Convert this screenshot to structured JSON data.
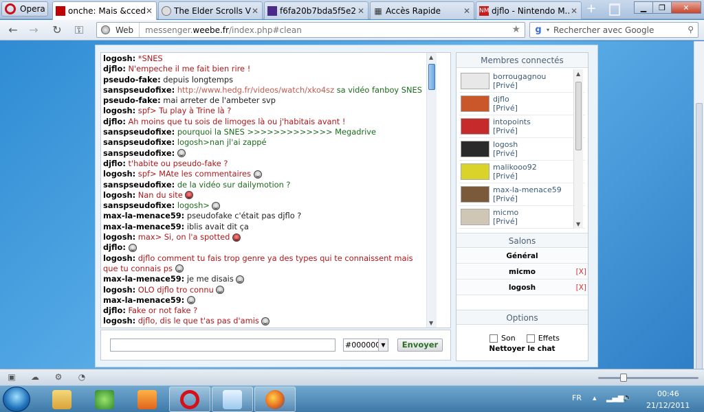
{
  "browser": {
    "menu_label": "Opera",
    "tabs": [
      {
        "title": "onche: Mais &cced...",
        "icon_color": "#c00000",
        "active": true
      },
      {
        "title": "The Elder Scrolls V: ...",
        "icon_color": "#888888",
        "active": false
      },
      {
        "title": "f6fa20b7bda5f5e23...",
        "icon_color": "#4b2a8a",
        "active": false
      },
      {
        "title": "Accès Rapide",
        "icon_color": "#556677",
        "active": false
      },
      {
        "title": "djflo - Nintendo M...",
        "icon_color": "#c81c1c",
        "active": false
      }
    ],
    "tab_icon_letters": [
      "",
      "",
      "",
      "",
      "NM"
    ],
    "address": {
      "web_label": "Web",
      "url_prefix": "messenger.",
      "url_domain": "weebe.fr",
      "url_suffix": "/index.php#clean"
    },
    "search_placeholder": "Rechercher avec Google"
  },
  "chat": {
    "messages": [
      {
        "user": "logosh:",
        "text": "*SNES",
        "color": "red"
      },
      {
        "user": "djflo:",
        "text": "N'empeche il me fait bien rire !",
        "color": "red"
      },
      {
        "user": "pseudo-fake:",
        "text": "depuis longtemps",
        "color": "dark"
      },
      {
        "user": "sanspseudofixe:",
        "text": "http://www.hedg.fr/videos/watch/xko4sz",
        "text2": " sa vidéo fanboy SNES",
        "color": "link"
      },
      {
        "user": "pseudo-fake:",
        "text": "mai arreter de l'ambeter svp",
        "color": "dark"
      },
      {
        "user": "logosh:",
        "text": "spf> Tu play à Trine là ?",
        "color": "red"
      },
      {
        "user": "djflo:",
        "text": "Ah moins que tu sois de limoges là ou j'habitais avant !",
        "color": "red"
      },
      {
        "user": "sanspseudofixe:",
        "text": "pourquoi la SNES >>>>>>>>>>>>> Megadrive",
        "color": "green"
      },
      {
        "user": "sanspseudofixe:",
        "text": "logosh>nan jl'ai zappé",
        "color": "green"
      },
      {
        "user": "sanspseudofixe:",
        "text": "",
        "color": "green",
        "smiley": true
      },
      {
        "user": "djflo:",
        "text": "t'habite ou pseudo-fake ?",
        "color": "red"
      },
      {
        "user": "logosh:",
        "text": "spf> MAte les commentaires",
        "color": "red",
        "smiley": true
      },
      {
        "user": "sanspseudofixe:",
        "text": "de la vidéo sur dailymotion ?",
        "color": "green"
      },
      {
        "user": "logosh:",
        "text": "Nan du site",
        "color": "red",
        "smiley": true,
        "smiley_red": true
      },
      {
        "user": "sanspseudofixe:",
        "text": "logosh>",
        "color": "green",
        "smiley": true
      },
      {
        "user": "max-la-menace59:",
        "text": "pseudofake c'était pas djflo ?",
        "color": "dark"
      },
      {
        "user": "max-la-menace59:",
        "text": "iblis avait dit ça",
        "color": "dark"
      },
      {
        "user": "logosh:",
        "text": "max> Si, on l'a spotted",
        "color": "red",
        "smiley": true,
        "smiley_red": true
      },
      {
        "user": "djflo:",
        "text": "",
        "color": "red",
        "smiley": true
      },
      {
        "user": "logosh:",
        "text": "djflo comment tu fais trop genre ya des types qui te connaissent mais que tu connais ps",
        "color": "red",
        "smiley": true
      },
      {
        "user": "max-la-menace59:",
        "text": "je me disais",
        "color": "dark",
        "smiley": true
      },
      {
        "user": "logosh:",
        "text": "OLO djflo tro connu",
        "color": "red",
        "smiley": true
      },
      {
        "user": "max-la-menace59:",
        "text": "",
        "color": "dark",
        "smiley": true
      },
      {
        "user": "djflo:",
        "text": "Fake or not fake ?",
        "color": "red"
      },
      {
        "user": "logosh:",
        "text": "djflo, dis le que t'as pas d'amis",
        "color": "red",
        "smiley": true
      }
    ],
    "color_value": "#000000",
    "send_label": "Envoyer"
  },
  "members": {
    "title": "Membres connectés",
    "list": [
      {
        "name": "borrougagnou",
        "status": "[Privé]",
        "avatar_color": "#e8e8e8"
      },
      {
        "name": "djflo",
        "status": "[Privé]",
        "avatar_color": "#c9572a"
      },
      {
        "name": "intopoints",
        "status": "[Privé]",
        "avatar_color": "#c62a2a"
      },
      {
        "name": "logosh",
        "status": "[Privé]",
        "avatar_color": "#2a2a2a"
      },
      {
        "name": "malikooo92",
        "status": "[Privé]",
        "avatar_color": "#d9d32a"
      },
      {
        "name": "max-la-menace59",
        "status": "[Privé]",
        "avatar_color": "#7a5a3a"
      },
      {
        "name": "micmo",
        "status": "[Privé]",
        "avatar_color": "#cfc6b5"
      }
    ]
  },
  "salons": {
    "title": "Salons",
    "list": [
      {
        "name": "Général",
        "close": ""
      },
      {
        "name": "micmo",
        "close": "[X]"
      },
      {
        "name": "logosh",
        "close": "[X]"
      }
    ]
  },
  "options": {
    "title": "Options",
    "sound_label": "Son",
    "effects_label": "Effets",
    "clear_label": "Nettoyer le chat"
  },
  "taskbar": {
    "lang": "FR",
    "time": "00:46",
    "date": "21/12/2011"
  }
}
